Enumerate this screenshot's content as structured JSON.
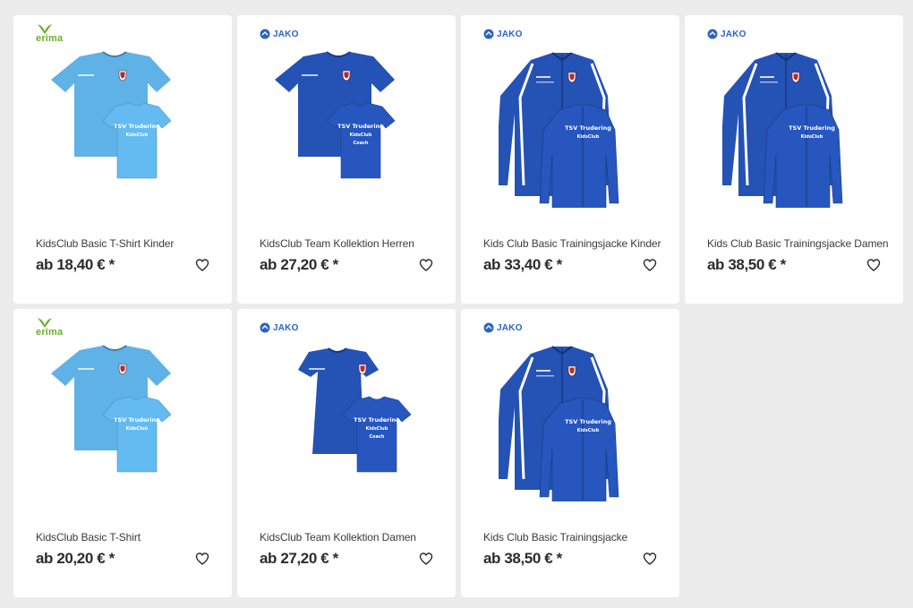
{
  "products": [
    {
      "brand": "erima",
      "brand_label": "erima",
      "name": "KidsClub Basic T-Shirt Kinder",
      "price": "ab 18,40 € *",
      "garment": "tshirt",
      "color": "#5fb2e6",
      "print": [
        "TSV Trudering",
        "KidsClub"
      ]
    },
    {
      "brand": "jako",
      "brand_label": "JAKO",
      "name": "KidsClub Team Kollektion Herren",
      "price": "ab 27,20 € *",
      "garment": "tshirt",
      "color": "#2452b5",
      "print": [
        "TSV Trudering",
        "KidsClub",
        "Coach"
      ]
    },
    {
      "brand": "jako",
      "brand_label": "JAKO",
      "name": "Kids Club Basic Trainingsjacke Kinder",
      "price": "ab 33,40 € *",
      "garment": "jacket",
      "color": "#2452b5",
      "print": [
        "TSV Trudering",
        "KidsClub"
      ]
    },
    {
      "brand": "jako",
      "brand_label": "JAKO",
      "name": "Kids Club Basic Trainingsjacke Damen",
      "price": "ab 38,50 € *",
      "garment": "jacket",
      "color": "#2452b5",
      "print": [
        "TSV Trudering",
        "KidsClub"
      ]
    },
    {
      "brand": "erima",
      "brand_label": "erima",
      "name": "KidsClub Basic T-Shirt",
      "price": "ab 20,20 € *",
      "garment": "tshirt",
      "color": "#5fb2e6",
      "print": [
        "TSV Trudering",
        "KidsClub"
      ]
    },
    {
      "brand": "jako",
      "brand_label": "JAKO",
      "name": "KidsClub Team Kollektion Damen",
      "price": "ab 27,20 € *",
      "garment": "tshirt-women",
      "color": "#2452b5",
      "print": [
        "TSV Trudering",
        "KidsClub",
        "Coach"
      ]
    },
    {
      "brand": "jako",
      "brand_label": "JAKO",
      "name": "Kids Club Basic Trainingsjacke",
      "price": "ab 38,50 € *",
      "garment": "jacket",
      "color": "#2452b5",
      "print": [
        "TSV Trudering",
        "KidsClub"
      ]
    }
  ],
  "colors": {
    "erima_green": "#6cae2e",
    "jako_blue": "#2a63c9"
  },
  "icons": {
    "wishlist": "heart-outline-icon"
  }
}
